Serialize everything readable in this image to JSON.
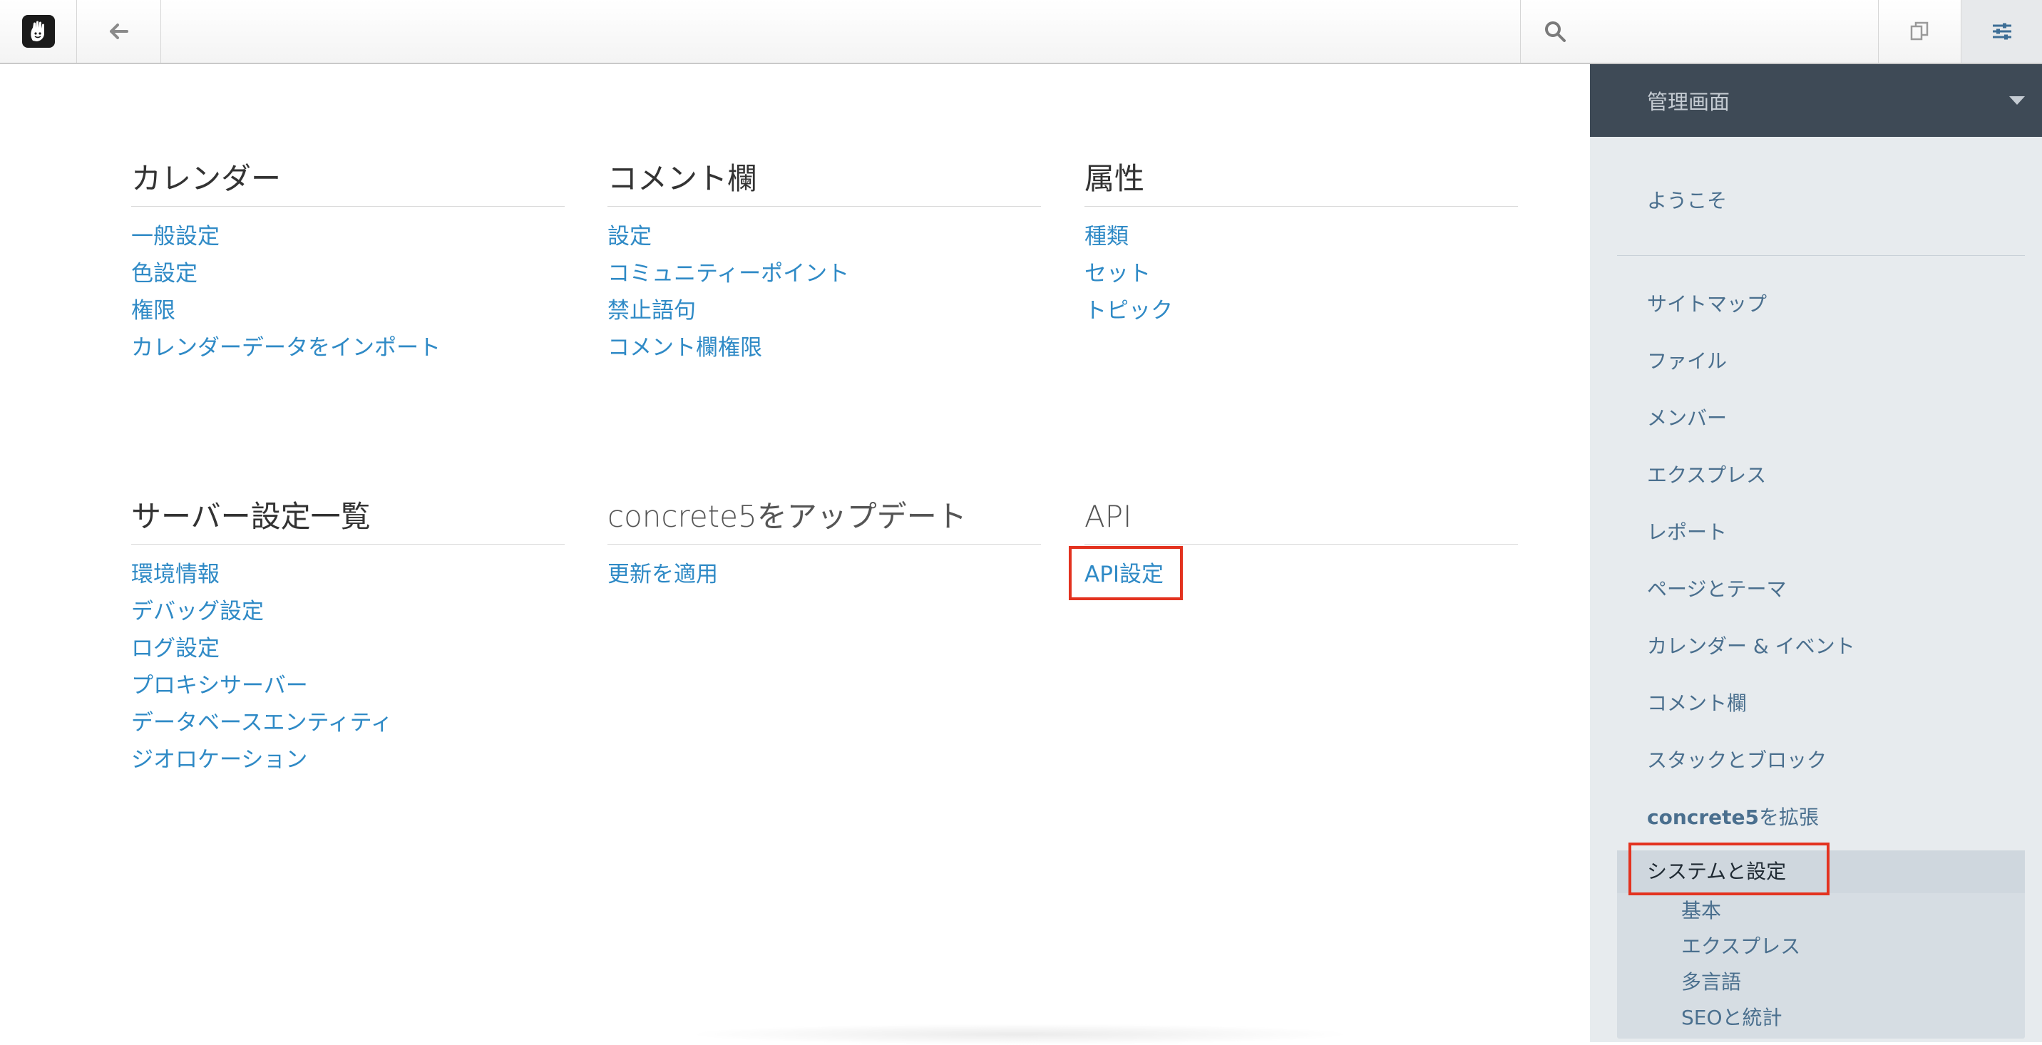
{
  "toolbar": {
    "logo_icon": "concrete5-hand-logo",
    "back_icon": "arrow-left-icon",
    "search_icon": "search-icon",
    "pages_icon": "pages-icon",
    "settings_icon": "sliders-icon"
  },
  "main": {
    "sections": [
      {
        "title": "カレンダー",
        "links": [
          "一般設定",
          "色設定",
          "権限",
          "カレンダーデータをインポート"
        ]
      },
      {
        "title": "コメント欄",
        "links": [
          "設定",
          "コミュニティーポイント",
          "禁止語句",
          "コメント欄権限"
        ]
      },
      {
        "title": "属性",
        "links": [
          "種類",
          "セット",
          "トピック"
        ]
      },
      {
        "title": "サーバー設定一覧",
        "links": [
          "環境情報",
          "デバッグ設定",
          "ログ設定",
          "プロキシサーバー",
          "データベースエンティティ",
          "ジオロケーション"
        ]
      },
      {
        "title": "concrete5をアップデート",
        "links": [
          "更新を適用"
        ]
      },
      {
        "title": "API",
        "links": [
          "API設定"
        ]
      }
    ]
  },
  "sidebar": {
    "header": "管理画面",
    "welcome": "ようこそ",
    "items": [
      "サイトマップ",
      "ファイル",
      "メンバー",
      "エクスプレス",
      "レポート",
      "ページとテーマ",
      "カレンダー & イベント",
      "コメント欄",
      "スタックとブロック"
    ],
    "extend": {
      "bold": "concrete5",
      "rest": "を拡張"
    },
    "active": "システムと設定",
    "sub_items": [
      "基本",
      "エクスプレス",
      "多言語",
      "SEOと統計"
    ]
  },
  "colors": {
    "link": "#2f8ac6",
    "sidebar_header": "#3e4a56",
    "sidebar_bg": "#e7ebee",
    "highlight": "#e3321f"
  }
}
